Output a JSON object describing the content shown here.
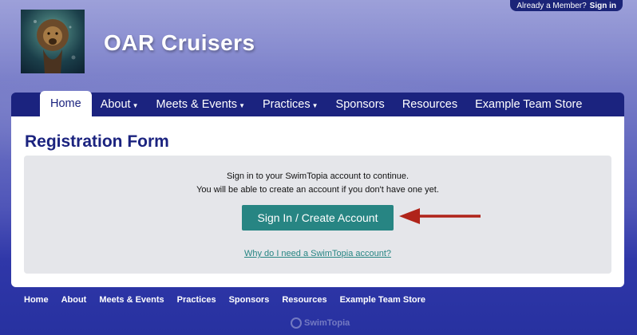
{
  "member_bar": {
    "prompt": "Already a Member?",
    "signin": "Sign in"
  },
  "site": {
    "title": "OAR Cruisers"
  },
  "nav": {
    "items": [
      {
        "label": "Home"
      },
      {
        "label": "About"
      },
      {
        "label": "Meets & Events"
      },
      {
        "label": "Practices"
      },
      {
        "label": "Sponsors"
      },
      {
        "label": "Resources"
      },
      {
        "label": "Example Team Store"
      }
    ]
  },
  "page": {
    "title": "Registration Form",
    "message_line1": "Sign in to your SwimTopia account to continue.",
    "message_line2": "You will be able to create an account if you don't have one yet.",
    "cta_label": "Sign In / Create Account",
    "why_link": "Why do I need a SwimTopia account?"
  },
  "footer": {
    "links": [
      "Home",
      "About",
      "Meets & Events",
      "Practices",
      "Sponsors",
      "Resources",
      "Example Team Store"
    ],
    "brand": "SwimTopia"
  },
  "colors": {
    "nav_bg": "#1b237f",
    "accent_teal": "#278583",
    "arrow_red": "#b0241a"
  },
  "icons": {
    "logo": "lion-underwater-logo",
    "arrow": "red-arrow-pointer-icon"
  }
}
